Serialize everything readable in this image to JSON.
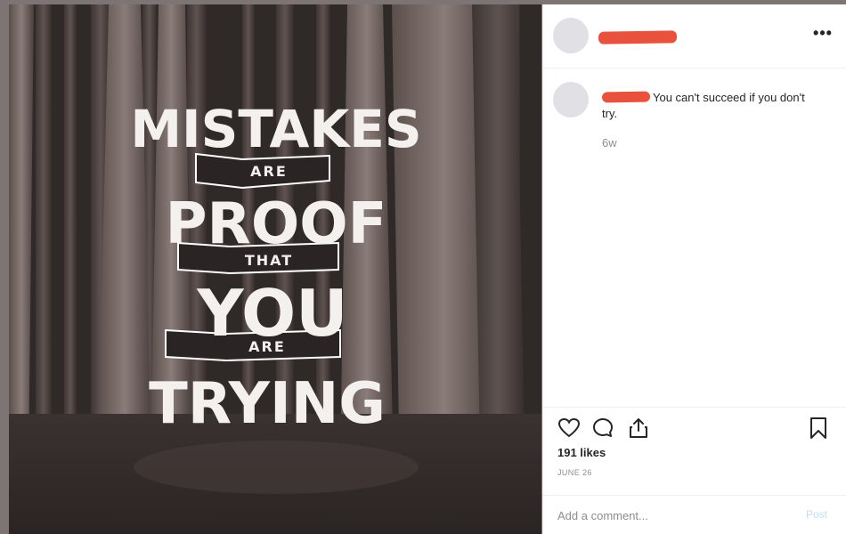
{
  "post": {
    "image": {
      "quote_lines": [
        "MISTAKES",
        "ARE",
        "PROOF",
        "THAT",
        "YOU",
        "ARE",
        "TRYING"
      ]
    },
    "header": {
      "username_redacted": true,
      "more_label": "•••"
    },
    "caption": {
      "text": "You can't succeed if you don't try.",
      "time": "6w"
    },
    "likes": "191 likes",
    "date": "JUNE 26",
    "comment_box": {
      "placeholder": "Add a comment...",
      "post_label": "Post"
    }
  },
  "icons": {
    "like": "heart-icon",
    "comment": "comment-bubble-icon",
    "share": "share-icon",
    "save": "bookmark-icon"
  }
}
